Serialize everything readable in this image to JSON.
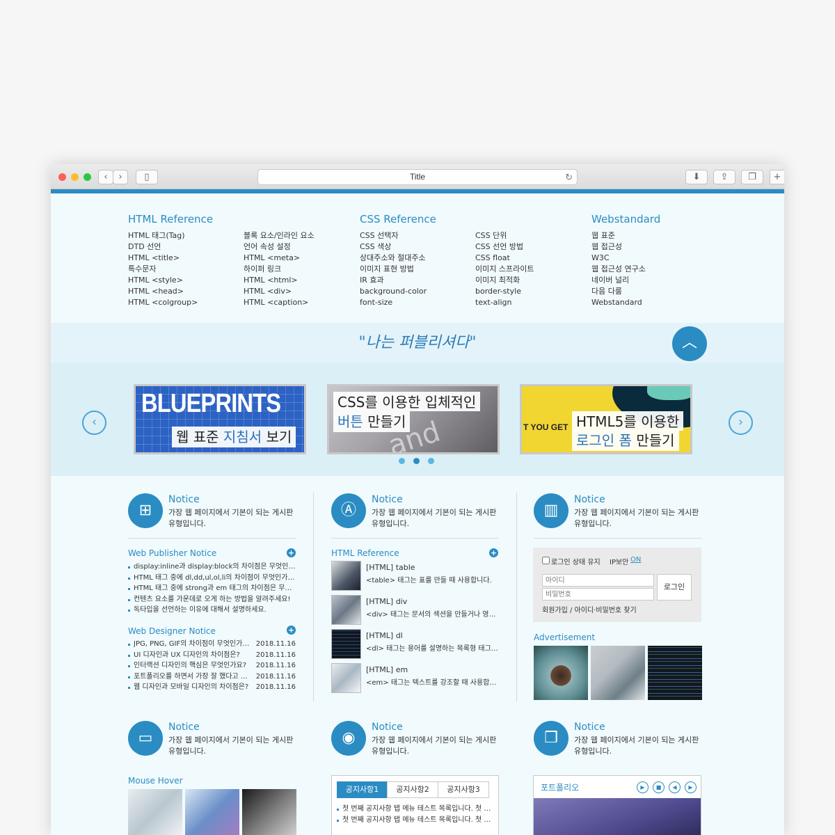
{
  "browser": {
    "title": "Title"
  },
  "references": [
    {
      "title": "HTML Reference",
      "col1": [
        "HTML 태그(Tag)",
        "DTD 선언",
        "HTML <title>",
        "특수문자",
        "HTML <style>",
        "HTML <head>",
        "HTML <colgroup>"
      ],
      "col2": [
        "블록 요소/인라인 요소",
        "언어 속성 설정",
        "HTML <meta>",
        "하이퍼 링크",
        "HTML <html>",
        "HTML <div>",
        "HTML <caption>"
      ]
    },
    {
      "title": "CSS Reference",
      "col1": [
        "CSS 선택자",
        "CSS 색상",
        "상대주소와 절대주소",
        "이미지 표현 방법",
        "IR 효과",
        "background-color",
        "font-size"
      ],
      "col2": [
        "CSS 단위",
        "CSS 선언 방법",
        "CSS float",
        "이미지 스프라이트",
        "이미지 최적화",
        "border-style",
        "text-align"
      ]
    },
    {
      "title": "Webstandard",
      "col1": [
        "웹 표준",
        "웹 접근성",
        "W3C",
        "웹 접근성 연구소",
        "네이버 널리",
        "다음 다룸",
        "Webstandard"
      ]
    }
  ],
  "quote": "\"나는 퍼블리셔다\"",
  "top_button_icon": "chevron-up-icon",
  "banners": [
    {
      "big": "BLUEPRINTS",
      "line1_a": "웹 표준 ",
      "line1_hl": "지침서",
      "line1_b": " 보기"
    },
    {
      "line1": "CSS를 이용한 입체적인",
      "line2_hl": "버튼",
      "line2_b": " 만들기",
      "bg_text": "and inte"
    },
    {
      "side": "T YOU GET",
      "line1": "HTML5를 이용한",
      "line2_hl": "로그인 폼",
      "line2_b": " 만들기"
    }
  ],
  "slider": {
    "prev_icon": "chevron-left-icon",
    "next_icon": "chevron-right-icon"
  },
  "notice": {
    "title": "Notice",
    "desc": "가장 웹 페이지에서 기본이 되는 게시판 유형입니다."
  },
  "publisher_notice": {
    "title": "Web Publisher Notice",
    "items": [
      "display:inline과 display:block의 차이점은 무엇인가요?",
      "HTML 태그 중에 dl,dd,ul,ol,li의 차이점이 무엇인가요?",
      "HTML 태그 중에 strong과 em 태그의 차이점은 무엇인가요?",
      "컨텐츠 요소를 가운데로 오게 하는 방법을 알려주세요!",
      "독타입을 선언하는 이유에 대해서 설명하세요."
    ]
  },
  "designer_notice": {
    "title": "Web Designer Notice",
    "items": [
      {
        "t": "JPG, PNG, GIF의 차이점이 무엇인가요?",
        "d": "2018.11.16"
      },
      {
        "t": "UI 디자인과 UX 디자인의 차이점은?",
        "d": "2018.11.16"
      },
      {
        "t": "인터랙션 디자인의 핵심은 무엇인가요?",
        "d": "2018.11.16"
      },
      {
        "t": "포트폴리오를 하면서 가장 잘 했다고 생각하는 것은?",
        "d": "2018.11.16"
      },
      {
        "t": "웹 디자인과 모바일 디자인의 차이점은?",
        "d": "2018.11.16"
      }
    ]
  },
  "html_reference_list": {
    "title": "HTML Reference",
    "items": [
      {
        "t": "[HTML] table",
        "d": "<table> 태그는 표를 만들 때 사용합니다."
      },
      {
        "t": "[HTML] div",
        "d": "<div> 태그는 문서의 섹션을 만들거나 영역을 구분합니다."
      },
      {
        "t": "[HTML] dl",
        "d": "<dl> 태그는 용어를 설명하는 목록형 태그입니다."
      },
      {
        "t": "[HTML] em",
        "d": "<em> 태그는 텍스트를 강조할 때 사용합니다."
      }
    ]
  },
  "login": {
    "keep": "로그인 상태 유지",
    "ip_label": "IP보안",
    "ip_state": "ON",
    "id_placeholder": "아이디",
    "pw_placeholder": "비밀번호",
    "button": "로그인",
    "links": "회원가입 / 아이디·비밀번호 찾기"
  },
  "advertisement": {
    "title": "Advertisement"
  },
  "mouse_hover": {
    "title": "Mouse Hover"
  },
  "tabs": {
    "labels": [
      "공지사항1",
      "공지사항2",
      "공지사항3"
    ],
    "items": [
      "첫 번째 공지사항 탭 메뉴 테스트 목록입니다. 첫 번째 공지사항",
      "첫 번째 공지사항 탭 메뉴 테스트 목록입니다. 첫 번째 공지사항"
    ]
  },
  "portfolio": {
    "title": "포트폴리오",
    "controls": [
      "play-icon",
      "stop-icon",
      "prev-icon",
      "next-icon"
    ]
  },
  "colors": {
    "accent": "#2a8cc2",
    "page_bg": "#f1fafd",
    "band": "#dbeff7"
  }
}
